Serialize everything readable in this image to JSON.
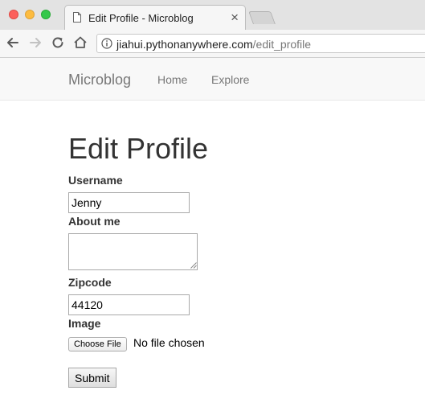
{
  "browser": {
    "tab_title": "Edit Profile - Microblog",
    "tab_close": "×",
    "url_host": "jiahui.pythonanywhere.com",
    "url_path": "/edit_profile"
  },
  "navbar": {
    "brand": "Microblog",
    "links": [
      {
        "label": "Home"
      },
      {
        "label": "Explore"
      }
    ]
  },
  "form": {
    "title": "Edit Profile",
    "username": {
      "label": "Username",
      "value": "Jenny"
    },
    "about_me": {
      "label": "About me",
      "value": ""
    },
    "zipcode": {
      "label": "Zipcode",
      "value": "44120"
    },
    "image": {
      "label": "Image",
      "button": "Choose File",
      "status": "No file chosen"
    },
    "submit": "Submit"
  }
}
